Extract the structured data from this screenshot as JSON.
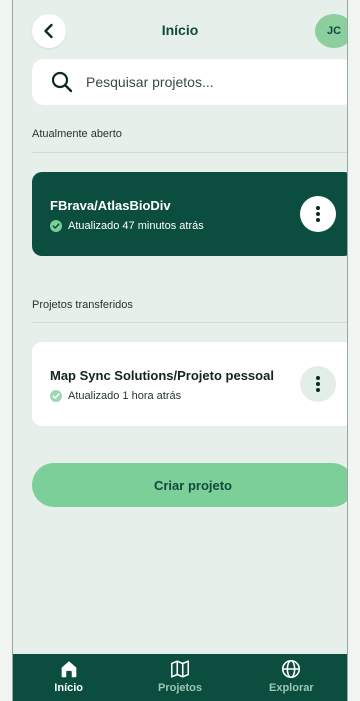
{
  "header": {
    "title": "Início",
    "avatar_initials": "JC"
  },
  "search": {
    "placeholder": "Pesquisar projetos..."
  },
  "sections": {
    "open_label": "Atualmente aberto",
    "transferred_label": "Projetos transferidos"
  },
  "open_project": {
    "name": "FBrava/AtlasBioDiv",
    "status": "Atualizado 47 minutos atrás"
  },
  "transferred_projects": [
    {
      "name": "Map Sync Solutions/Projeto pessoal",
      "status": "Atualizado 1 hora atrás"
    }
  ],
  "create_button": "Criar projeto",
  "nav": [
    {
      "label": "Início",
      "icon": "home-icon",
      "active": true
    },
    {
      "label": "Projetos",
      "icon": "map-icon",
      "active": false
    },
    {
      "label": "Explorar",
      "icon": "globe-icon",
      "active": false
    }
  ],
  "colors": {
    "primary_dark": "#0b4d3e",
    "accent_green": "#7ccf98",
    "background": "#e6efe9"
  }
}
